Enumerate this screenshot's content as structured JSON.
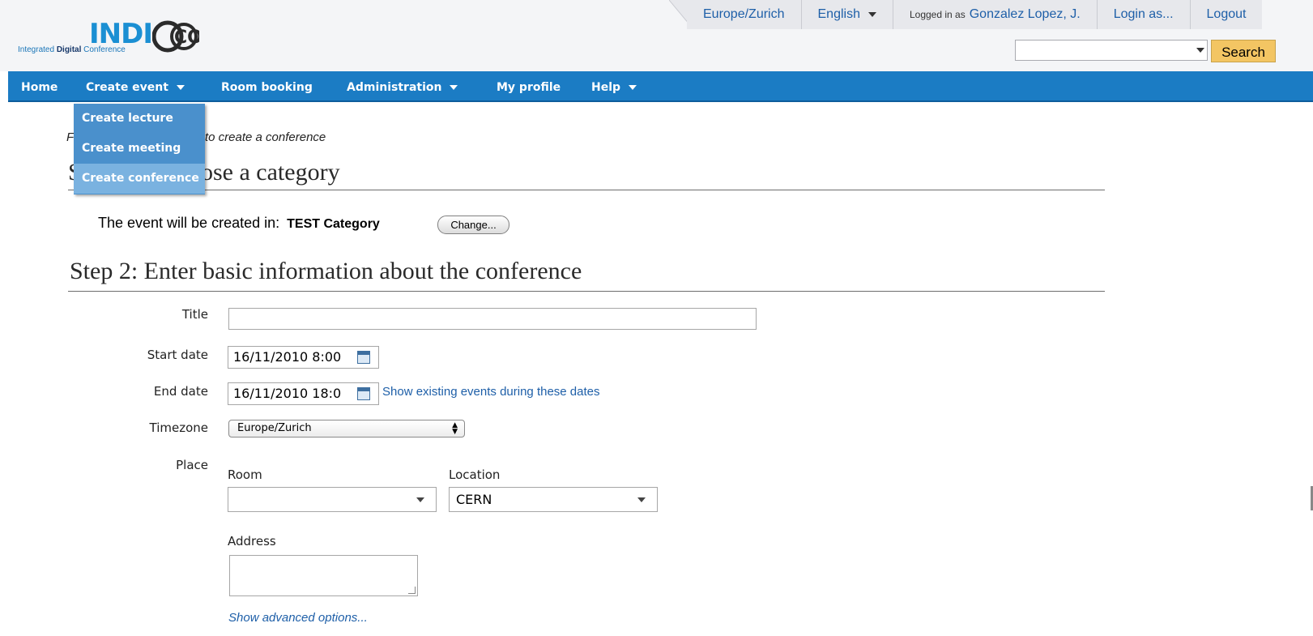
{
  "header": {
    "logo_text": "INDI",
    "logo_co": "CO",
    "tagline_a": "Integrated ",
    "tagline_b": "Digital",
    "tagline_c": " Conference",
    "topbar": {
      "timezone": "Europe/Zurich",
      "language": "English",
      "logged_in_prefix": "Logged in as",
      "user": "Gonzalez Lopez, J.",
      "login_as": "Login as...",
      "logout": "Logout"
    },
    "search": {
      "value": "",
      "button": "Search"
    }
  },
  "nav": {
    "home": "Home",
    "create_event": "Create event",
    "room_booking": "Room booking",
    "administration": "Administration",
    "my_profile": "My profile",
    "help": "Help"
  },
  "dropdown": {
    "items": [
      "Create lecture",
      "Create meeting",
      "Create conference"
    ],
    "active_index": 2
  },
  "content": {
    "intro_hidden_start": "F",
    "intro_visible": "to create a conference",
    "step1_hidden_start": "S",
    "step1_visible": "ose a category",
    "category_prefix": "The event will be created in:",
    "category_name": "TEST Category",
    "change_button": "Change...",
    "step2_heading": "Step 2: Enter basic information about the conference",
    "form": {
      "title_label": "Title",
      "title_value": "",
      "start_label": "Start date",
      "start_value": "16/11/2010 8:00",
      "end_label": "End date",
      "end_value": "16/11/2010 18:0",
      "show_existing": "Show existing events during these dates",
      "timezone_label": "Timezone",
      "timezone_value": "Europe/Zurich",
      "place_label": "Place",
      "room_label": "Room",
      "room_value": "",
      "location_label": "Location",
      "location_value": "CERN",
      "address_label": "Address",
      "address_value": "",
      "advanced_link": "Show advanced options..."
    }
  },
  "colors": {
    "nav_blue": "#1b7cc4",
    "dropdown_blue": "#4a90cc",
    "dropdown_active": "#7ab2e0",
    "link_blue": "#1e5fa8",
    "search_button": "#f3c563"
  }
}
